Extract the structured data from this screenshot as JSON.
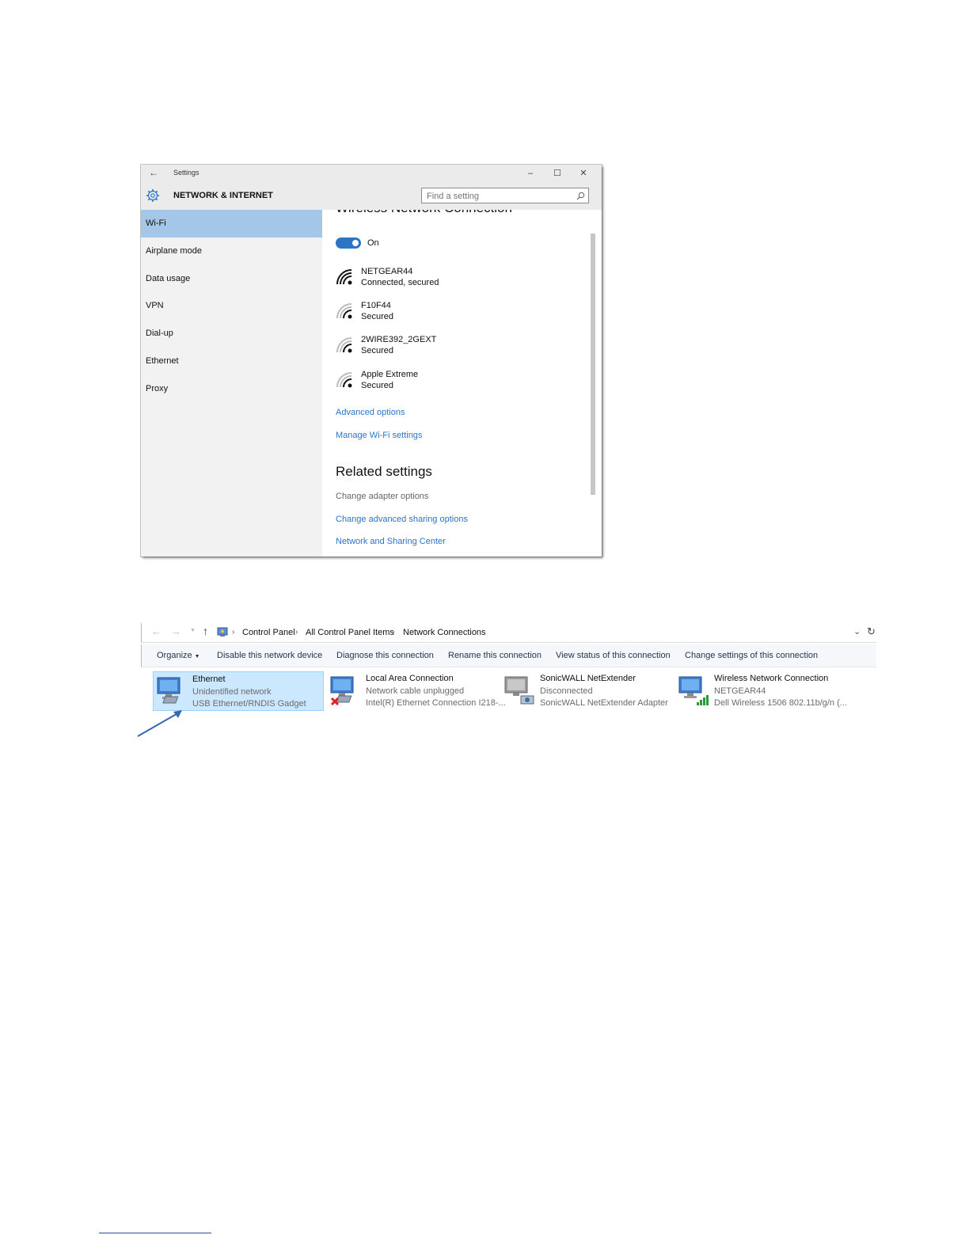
{
  "settings_window": {
    "title": "Settings",
    "section_title": "NETWORK & INTERNET",
    "search": {
      "placeholder": "Find a setting"
    },
    "nav": [
      {
        "label": "Wi-Fi",
        "active": true
      },
      {
        "label": "Airplane mode"
      },
      {
        "label": "Data usage"
      },
      {
        "label": "VPN"
      },
      {
        "label": "Dial-up"
      },
      {
        "label": "Ethernet"
      },
      {
        "label": "Proxy"
      }
    ],
    "content": {
      "partial_heading": "Wireless Network Connection",
      "toggle_label": "On",
      "toggle_on": true,
      "networks": [
        {
          "name": "NETGEAR44",
          "status": "Connected, secured"
        },
        {
          "name": "F10F44",
          "status": "Secured"
        },
        {
          "name": "2WIRE392_2GEXT",
          "status": "Secured"
        },
        {
          "name": "Apple Extreme",
          "status": "Secured"
        }
      ],
      "advanced_options": "Advanced options",
      "manage_wifi": "Manage Wi-Fi settings",
      "related_heading": "Related settings",
      "related": {
        "change_adapter": "Change adapter options",
        "change_sharing": "Change advanced sharing options",
        "network_center": "Network and Sharing Center"
      }
    }
  },
  "explorer": {
    "breadcrumb": [
      "Control Panel",
      "All Control Panel Items",
      "Network Connections"
    ],
    "commands": {
      "organize": "Organize",
      "disable": "Disable this network device",
      "diagnose": "Diagnose this connection",
      "rename": "Rename this connection",
      "view_status": "View status of this connection",
      "change_settings": "Change settings of this connection"
    },
    "connections": [
      {
        "name": "Ethernet",
        "status": "Unidentified network",
        "device": "USB Ethernet/RNDIS Gadget",
        "selected": true,
        "icon": "ethernet-adapter-icon"
      },
      {
        "name": "Local Area Connection",
        "status": "Network cable unplugged",
        "device": "Intel(R) Ethernet Connection I218-...",
        "icon": "ethernet-unplugged-icon"
      },
      {
        "name": "SonicWALL NetExtender",
        "status": "Disconnected",
        "device": "SonicWALL NetExtender Adapter",
        "icon": "vpn-adapter-icon"
      },
      {
        "name": "Wireless Network Connection",
        "status": "NETGEAR44",
        "device": "Dell Wireless 1506 802.11b/g/n (...",
        "icon": "wireless-adapter-icon"
      }
    ]
  },
  "colors": {
    "accent": "#2b74c6",
    "nav_active": "#a4c6e8",
    "selection": "#cce8ff",
    "arrow": "#3a66b0"
  }
}
